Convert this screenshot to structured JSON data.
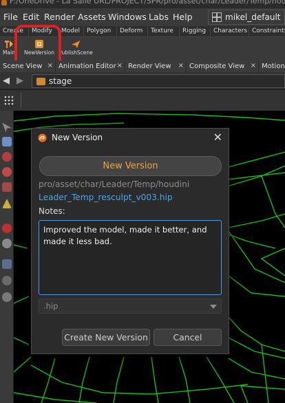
{
  "window": {
    "title": "F:/OneDrive - La Salle URL/PROJECT/SPR/pro/asset/char/Leader/Temp/houdi"
  },
  "menubar": {
    "items": [
      "File",
      "Edit",
      "Render",
      "Assets",
      "Windows",
      "Labs",
      "Help"
    ],
    "desktop": "mikel_default"
  },
  "shelf": {
    "tabs": [
      "Create",
      "Modify",
      "Model",
      "Polygon",
      "Deform",
      "Texture",
      "Rigging",
      "Characters",
      "Constraints"
    ],
    "tools": [
      {
        "label": "Main",
        "icon": "main-tool-icon"
      },
      {
        "label": "NewVersion",
        "icon": "new-version-icon"
      },
      {
        "label": "PublishScene",
        "icon": "publish-scene-icon"
      }
    ]
  },
  "panes": {
    "tabs": [
      "Scene View",
      "Animation Editor",
      "Render View",
      "Composite View",
      "Motion"
    ]
  },
  "pathbar": {
    "path": "stage"
  },
  "dialog": {
    "title": "New Version",
    "version_button": "New Version",
    "directory": "pro/asset/char/Leader/Temp/houdini",
    "filename": "Leader_Temp_resculpt_v003.hip",
    "notes_label": "Notes:",
    "notes_text": "Improved the model, made it better, and made it less bad.",
    "extension": ".hip",
    "create_button": "Create New Version",
    "cancel_button": "Cancel"
  },
  "colors": {
    "accent": "#f0a340",
    "link": "#4aa6e8",
    "wireframe": "#18d418",
    "annotation": "#e02020"
  }
}
